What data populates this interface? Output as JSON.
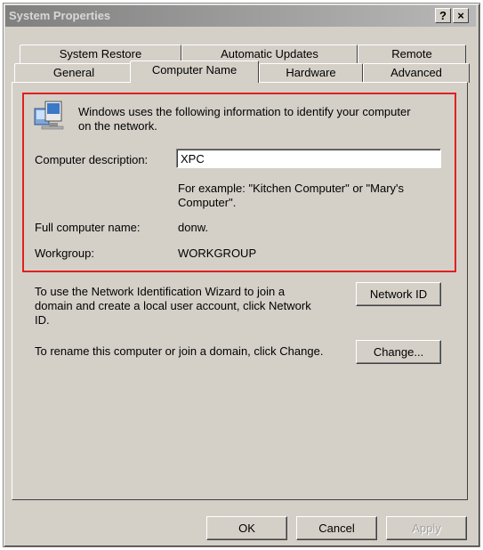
{
  "window": {
    "title": "System Properties",
    "help_button": "?",
    "close_button": "×"
  },
  "tabs": {
    "row1": [
      "System Restore",
      "Automatic Updates",
      "Remote"
    ],
    "row2": [
      "General",
      "Computer Name",
      "Hardware",
      "Advanced"
    ],
    "active": "Computer Name"
  },
  "identification": {
    "intro_line1": "Windows uses the following information to identify your computer",
    "intro_line2": "on the network.",
    "description_label": "Computer description:",
    "description_value": "XPC",
    "example_line1": "For example: \"Kitchen Computer\" or \"Mary's",
    "example_line2": "Computer\".",
    "full_name_label": "Full computer name:",
    "full_name_value": "donw.",
    "workgroup_label": "Workgroup:",
    "workgroup_value": "WORKGROUP"
  },
  "network_id": {
    "text_line1": "To use the Network Identification Wizard to join a",
    "text_line2": "domain and create a local user account, click Network",
    "text_line3": "ID.",
    "button_label": "Network ID"
  },
  "rename": {
    "text": "To rename this computer or join a domain, click Change.",
    "button_label": "Change..."
  },
  "footer": {
    "ok_label": "OK",
    "cancel_label": "Cancel",
    "apply_label": "Apply"
  },
  "colors": {
    "dialog_face": "#d4d0c8",
    "highlight_border": "#e02020",
    "titlebar_inactive": "#808080"
  }
}
